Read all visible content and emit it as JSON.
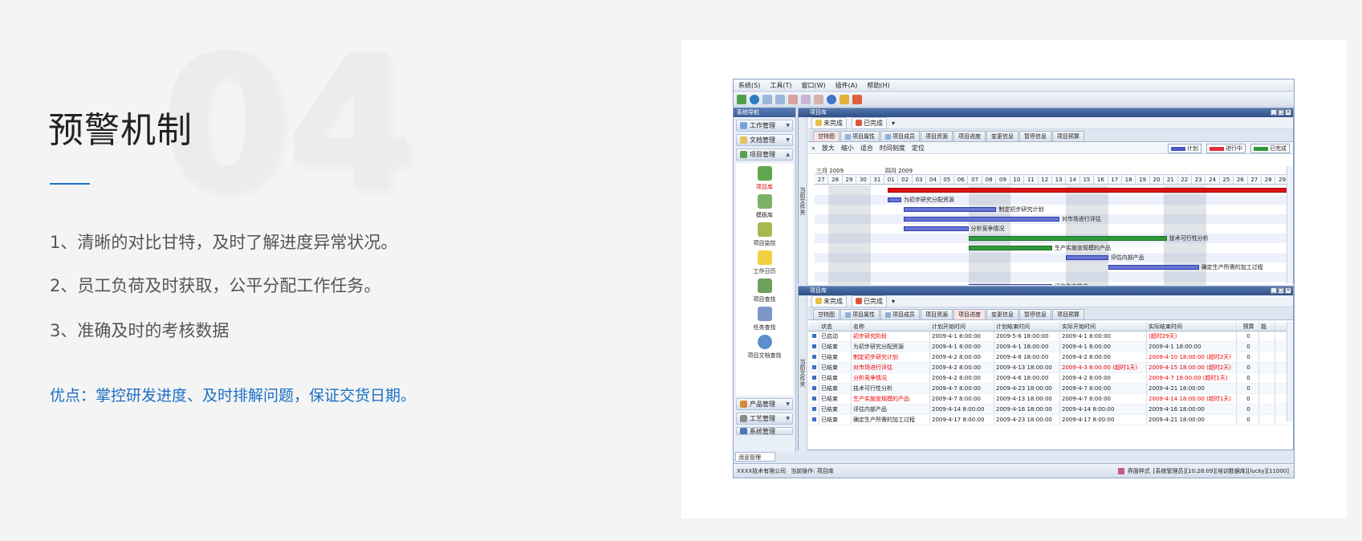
{
  "hero": {
    "number": "04",
    "title": "预警机制",
    "points": [
      "1、清晰的对比甘特，及时了解进度异常状况。",
      "2、员工负荷及时获取，公平分配工作任务。",
      "3、准确及时的考核数据"
    ],
    "advantage": "优点：掌控研发进度、及时排解问题，保证交货日期。"
  },
  "app": {
    "menu": [
      "系统(S)",
      "工具(T)",
      "窗口(W)",
      "插件(A)",
      "帮助(H)"
    ],
    "nav": {
      "header": "系统导航",
      "groups_top": [
        "工作管理",
        "文档管理",
        "项目管理"
      ],
      "items": [
        "项目库",
        "模板库",
        "项目监控",
        "工作日历",
        "项目查找",
        "任务查找",
        "项目文档查找"
      ],
      "groups_bottom": [
        "产品管理",
        "工艺管理",
        "系统管理"
      ],
      "message_tab": "消息管理"
    },
    "panel_top": {
      "title": "项目库",
      "vtab": "当前文件夹",
      "filters": [
        "未完成",
        "已完成"
      ],
      "tabs": [
        "甘特图",
        "项目属性",
        "项目成员",
        "项目资源",
        "项目进度",
        "变更信息",
        "暂停信息",
        "项目预算"
      ],
      "gantt_tools": [
        "放大",
        "缩小",
        "适合",
        "时间刻度",
        "定位"
      ],
      "legend": [
        "计划",
        "进行中",
        "已完成"
      ],
      "months": [
        "三月 2009",
        "四月 2009"
      ],
      "days": [
        "27",
        "28",
        "29",
        "30",
        "31",
        "01",
        "02",
        "03",
        "04",
        "05",
        "06",
        "07",
        "08",
        "09",
        "10",
        "11",
        "12",
        "13",
        "14",
        "15",
        "16",
        "17",
        "18",
        "19",
        "20",
        "21",
        "22",
        "23",
        "24",
        "25",
        "26",
        "27",
        "28",
        "29"
      ],
      "task_labels": [
        "为初步研究分配资源",
        "制定初步研究计划",
        "对市场进行评估",
        "分析竞争情况",
        "技术可行性分析",
        "生产实施宣规模的产品",
        "评估内部产品",
        "确定生产所需的加工过程",
        "评估生产能力"
      ]
    },
    "panel_bottom": {
      "title": "项目库",
      "vtab": "当前文件夹",
      "filters": [
        "未完成",
        "已完成"
      ],
      "tabs": [
        "甘特图",
        "项目属性",
        "项目成员",
        "项目资源",
        "项目进度",
        "变更信息",
        "暂停信息",
        "项目预算"
      ],
      "columns": [
        "",
        "状态",
        "名称",
        "计划开始时间",
        "计划结束时间",
        "实际开始时间",
        "实际结束时间",
        "预算",
        "能"
      ],
      "rows": [
        {
          "status": "已启动",
          "name": "初步研究阶段",
          "ps": "2009-4-1 8:00:00",
          "pe": "2009-5-6 18:00:00",
          "as": "2009-4-1 8:00:00",
          "ae": "(超时29天)",
          "budget": "0",
          "red": true
        },
        {
          "status": "已结束",
          "name": "为初步研究分配资源",
          "ps": "2009-4-1 8:00:00",
          "pe": "2009-4-1 18:00:00",
          "as": "2009-4-1 8:00:00",
          "ae": "2009-4-1 18:00:00",
          "budget": "0",
          "red": false
        },
        {
          "status": "已结束",
          "name": "制定初步研究计划",
          "ps": "2009-4-2 8:00:00",
          "pe": "2009-4-8 18:00:00",
          "as": "2009-4-2 8:00:00",
          "ae": "2009-4-10 18:00:00 (超时2天)",
          "budget": "0",
          "red": true
        },
        {
          "status": "已结束",
          "name": "对市场进行评估",
          "ps": "2009-4-2 8:00:00",
          "pe": "2009-4-13 18:00:00",
          "as": "2009-4-3 8:00:00 (超时1天)",
          "ae": "2009-4-15 18:00:00 (超时2天)",
          "budget": "0",
          "red": true
        },
        {
          "status": "已结束",
          "name": "分析竞争情况",
          "ps": "2009-4-2 8:00:00",
          "pe": "2009-4-6 18:00:00",
          "as": "2009-4-2 8:00:00",
          "ae": "2009-4-7 18:00:00 (超时1天)",
          "budget": "0",
          "red": true
        },
        {
          "status": "已结束",
          "name": "技术可行性分析",
          "ps": "2009-4-7 8:00:00",
          "pe": "2009-4-23 18:00:00",
          "as": "2009-4-7 8:00:00",
          "ae": "2009-4-21 18:00:00",
          "budget": "0",
          "red": false
        },
        {
          "status": "已结束",
          "name": "生产实施宣规模的产品",
          "ps": "2009-4-7 8:00:00",
          "pe": "2009-4-13 18:00:00",
          "as": "2009-4-7 8:00:00",
          "ae": "2009-4-14 18:00:00 (超时1天)",
          "budget": "0",
          "red": true
        },
        {
          "status": "已结束",
          "name": "评估内部产品",
          "ps": "2009-4-14 8:00:00",
          "pe": "2009-4-16 18:00:00",
          "as": "2009-4-14 8:00:00",
          "ae": "2009-4-16 18:00:00",
          "budget": "0",
          "red": false
        },
        {
          "status": "已结束",
          "name": "确定生产所需的加工过程",
          "ps": "2009-4-17 8:00:00",
          "pe": "2009-4-23 18:00:00",
          "as": "2009-4-17 8:00:00",
          "ae": "2009-4-21 18:00:00",
          "budget": "0",
          "red": false
        }
      ]
    },
    "status": {
      "company": "XXXX技术有限公司",
      "current_op": "当前操作: 项目库",
      "skin": "界面样式",
      "user": "[系统管理员][10:28:09][培训数据库][lucky][11000]"
    },
    "colors": {
      "plan": "#4a56c8",
      "progress": "#e0303a",
      "done": "#2f9a3b"
    }
  }
}
